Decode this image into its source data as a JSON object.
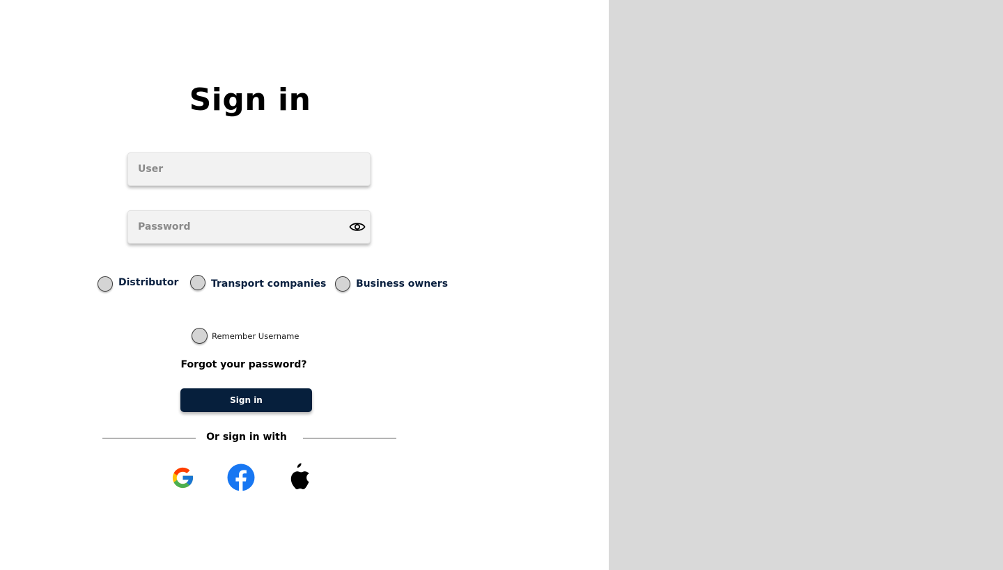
{
  "signin": {
    "title": "Sign in",
    "user_placeholder": "User",
    "password_placeholder": "Password",
    "roles": [
      {
        "label": "Distributor"
      },
      {
        "label": "Transport companies"
      },
      {
        "label": "Business owners"
      }
    ],
    "remember_label": "Remember Username",
    "forgot_label": "Forgot your password?",
    "submit_label": "Sign in",
    "divider_label": "Or sign in with",
    "social": [
      {
        "icon": "google-icon"
      },
      {
        "icon": "facebook-icon"
      },
      {
        "icon": "apple-icon"
      }
    ]
  },
  "colors": {
    "primary": "#061f3c",
    "role_text": "#0b2140",
    "side_panel": "#d9d9d9",
    "facebook": "#1877f2"
  }
}
